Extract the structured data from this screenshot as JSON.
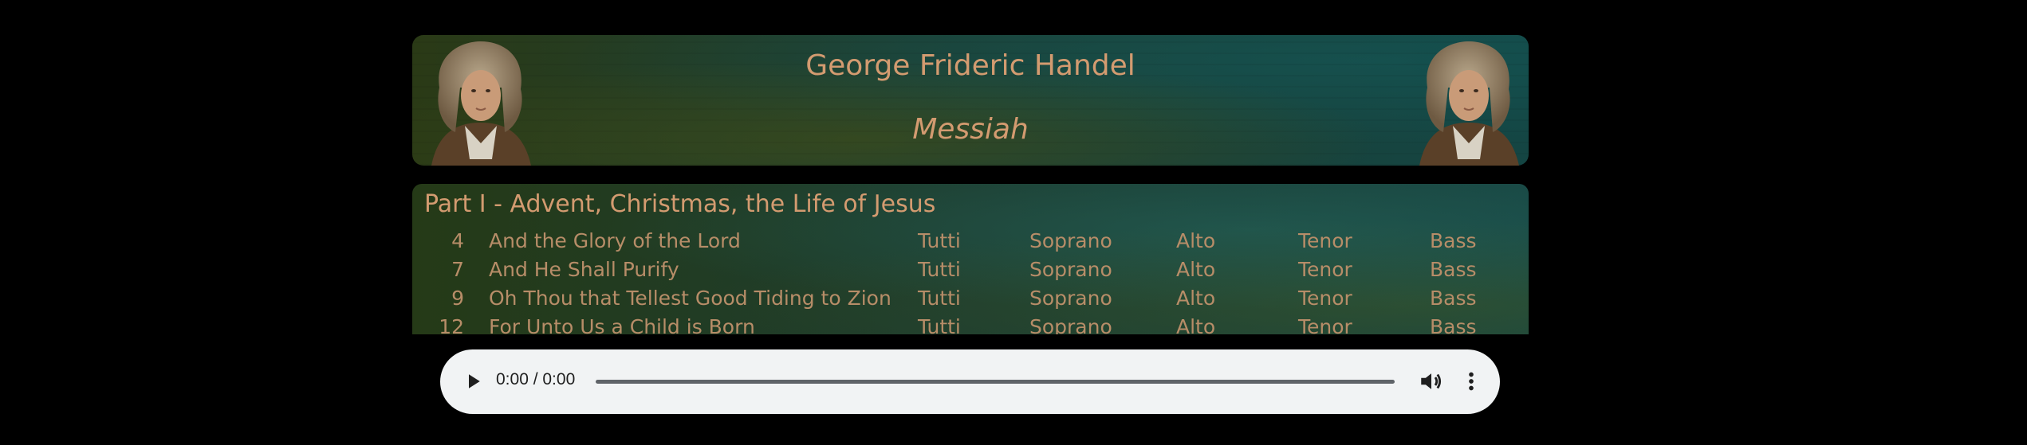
{
  "header": {
    "composer": "George Frideric Handel",
    "work": "Messiah",
    "portrait_icon": "composer-portrait"
  },
  "part": {
    "title": "Part I - Advent, Christmas, the Life of Jesus",
    "tracks": [
      {
        "number": "4",
        "title": "And the Glory of the Lord",
        "tutti": "Tutti",
        "soprano": "Soprano",
        "alto": "Alto",
        "tenor": "Tenor",
        "bass": "Bass"
      },
      {
        "number": "7",
        "title": "And He Shall Purify",
        "tutti": "Tutti",
        "soprano": "Soprano",
        "alto": "Alto",
        "tenor": "Tenor",
        "bass": "Bass"
      },
      {
        "number": "9",
        "title": "Oh Thou that Tellest Good Tiding to Zion",
        "tutti": "Tutti",
        "soprano": "Soprano",
        "alto": "Alto",
        "tenor": "Tenor",
        "bass": "Bass"
      },
      {
        "number": "12",
        "title": "For Unto Us a Child is Born",
        "tutti": "Tutti",
        "soprano": "Soprano",
        "alto": "Alto",
        "tenor": "Tenor",
        "bass": "Bass"
      }
    ]
  },
  "player": {
    "time": "0:00 / 0:00",
    "progress": 0,
    "play_icon": "play-icon",
    "volume_icon": "volume-icon",
    "menu_icon": "more-vert-icon"
  },
  "colors": {
    "text_accent": "#d39b70",
    "row_text": "#b78d68",
    "player_bg": "#f1f3f4"
  }
}
